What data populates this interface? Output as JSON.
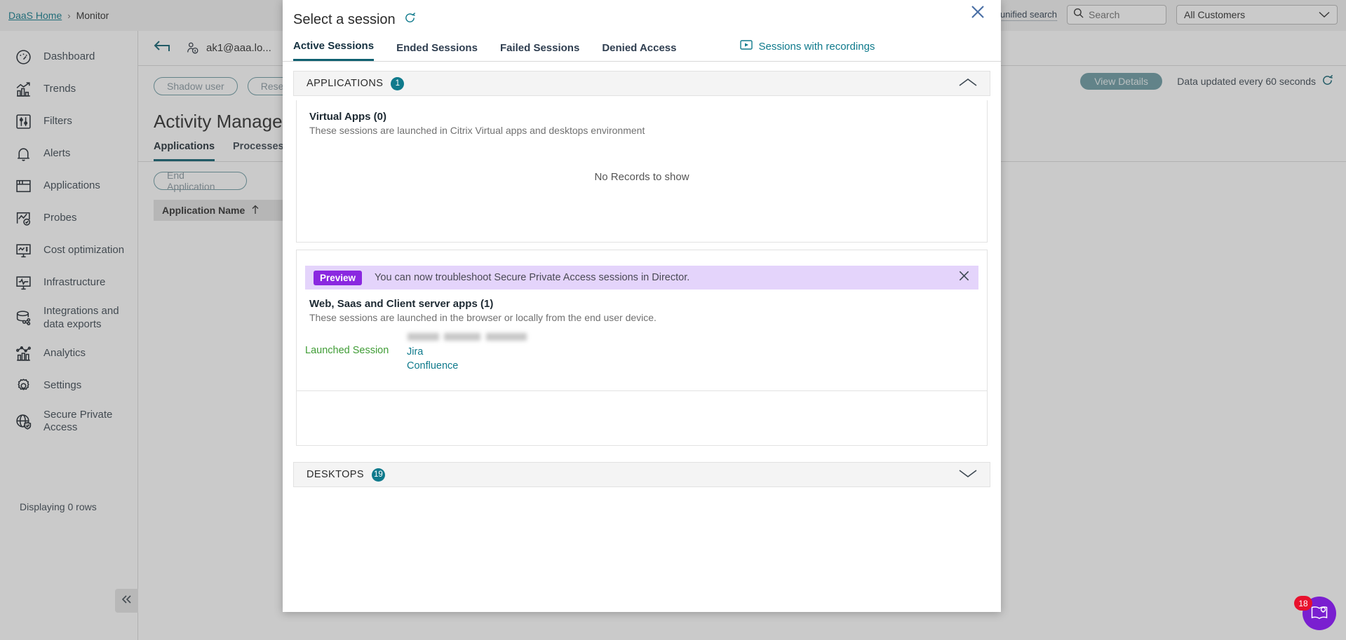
{
  "breadcrumb": {
    "home": "DaaS Home",
    "separator": "›",
    "current": "Monitor"
  },
  "header": {
    "unified_search_label": "Try unified search",
    "unified_search_icon": "unified-search-icon",
    "search_placeholder": "Search",
    "customer_select_value": "All Customers"
  },
  "sidebar": {
    "items": [
      {
        "label": "Dashboard",
        "icon": "gauge-icon"
      },
      {
        "label": "Trends",
        "icon": "trend-chart-icon"
      },
      {
        "label": "Filters",
        "icon": "sliders-icon"
      },
      {
        "label": "Alerts",
        "icon": "bell-icon"
      },
      {
        "label": "Applications",
        "icon": "window-icon"
      },
      {
        "label": "Probes",
        "icon": "probe-check-icon"
      },
      {
        "label": "Cost optimization",
        "icon": "monitor-dollar-icon"
      },
      {
        "label": "Infrastructure",
        "icon": "monitor-pulse-icon"
      },
      {
        "label": "Integrations and data exports",
        "icon": "database-share-icon"
      },
      {
        "label": "Analytics",
        "icon": "analytics-bar-icon"
      },
      {
        "label": "Settings",
        "icon": "gear-icon"
      },
      {
        "label": "Secure Private Access",
        "icon": "globe-shield-icon"
      }
    ],
    "collapse_icon": "double-chevron-left-icon"
  },
  "main": {
    "back_icon": "back-arrow-icon",
    "user_icon": "user-info-icon",
    "user_name": "ak1@aaa.lo...",
    "device_icon": "monitor-icon",
    "actions": [
      {
        "label": "Shadow user"
      },
      {
        "label": "Rese"
      }
    ],
    "page_title": "Activity Manager",
    "tabs": [
      {
        "label": "Applications",
        "active": true
      },
      {
        "label": "Processes",
        "active": false
      }
    ],
    "end_application_label": "End Application",
    "table_header": "Application Name",
    "sort_icon": "sort-asc-icon",
    "rows_note": "Displaying 0 rows",
    "view_details_label": "View Details",
    "data_updated_label": "Data updated every 60 seconds",
    "refresh_icon": "refresh-icon"
  },
  "modal": {
    "title": "Select a session",
    "refresh_icon": "refresh-icon",
    "close_icon": "close-icon",
    "tabs": [
      {
        "label": "Active Sessions",
        "active": true
      },
      {
        "label": "Ended Sessions",
        "active": false
      },
      {
        "label": "Failed Sessions",
        "active": false
      },
      {
        "label": "Denied Access",
        "active": false
      }
    ],
    "recordings_link": {
      "label": "Sessions with recordings",
      "icon": "recording-icon"
    },
    "applications_section": {
      "title": "APPLICATIONS",
      "count": "1",
      "chevron": "chevron-up-icon",
      "virtual_apps": {
        "title": "Virtual Apps (0)",
        "subtitle": "These sessions are launched in Citrix Virtual apps and desktops environment",
        "empty_message": "No Records to show"
      },
      "preview_banner": {
        "tag": "Preview",
        "message": "You can now troubleshoot Secure Private Access sessions in Director.",
        "close_icon": "close-icon"
      },
      "web_saas": {
        "title": "Web, Saas and Client server apps (1)",
        "subtitle": "These sessions are launched in the browser or locally from the end user device.",
        "row_label": "Launched Session",
        "apps": [
          "Jira",
          "Confluence"
        ]
      }
    },
    "desktops_section": {
      "title": "DESKTOPS",
      "count": "19",
      "chevron": "chevron-down-icon"
    }
  },
  "chat": {
    "badge": "18",
    "icon": "book-idea-icon"
  },
  "colors": {
    "accent_teal": "#0f7a8c",
    "link_teal": "#0f7a8c",
    "green": "#3f9c35",
    "purple": "#8a28e0",
    "badge_red": "#e8112d"
  }
}
